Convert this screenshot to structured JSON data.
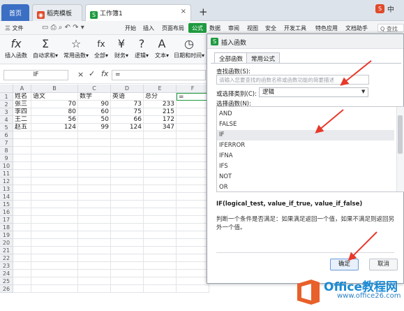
{
  "tabs": {
    "home": "首页",
    "template": "稻壳模板",
    "doc": "工作簿1",
    "close": "×",
    "plus": "+"
  },
  "topright": {
    "badge": "S",
    "lang": "中"
  },
  "menu": {
    "file": "三 文件",
    "items": [
      "开始",
      "插入",
      "页面布局",
      "公式",
      "数据",
      "审阅",
      "视图",
      "安全",
      "开发工具",
      "特色应用",
      "文档助手"
    ],
    "search": "Q 查找"
  },
  "ribbon": [
    {
      "icon": "fx",
      "label": "插入函数"
    },
    {
      "icon": "Σ",
      "label": "自动求和▾"
    },
    {
      "icon": "☆",
      "label": "常用函数▾"
    },
    {
      "icon": "fx",
      "label": "全部▾"
    },
    {
      "icon": "¥",
      "label": "财务▾"
    },
    {
      "icon": "?",
      "label": "逻辑▾"
    },
    {
      "icon": "A",
      "label": "文本▾"
    },
    {
      "icon": "◷",
      "label": "日期和时间▾"
    }
  ],
  "formulabar": {
    "name": "IF",
    "x": "×",
    "check": "✓",
    "fx": "fx",
    "content": "="
  },
  "grid": {
    "columns": [
      "A",
      "B",
      "C",
      "D",
      "E",
      "F"
    ],
    "rows": [
      "1",
      "2",
      "3",
      "4",
      "5",
      "6",
      "7",
      "8",
      "9",
      "10",
      "11",
      "12",
      "13",
      "14",
      "15",
      "16",
      "17",
      "18",
      "19",
      "20",
      "21",
      "22",
      "23",
      "24",
      "25",
      "26"
    ],
    "header": [
      "姓名",
      "语文",
      "数学",
      "英语",
      "总分",
      "="
    ],
    "data": [
      [
        "张三",
        "70",
        "90",
        "73",
        "233"
      ],
      [
        "李四",
        "80",
        "60",
        "75",
        "215"
      ],
      [
        "王二",
        "56",
        "50",
        "66",
        "172"
      ],
      [
        "赵五",
        "124",
        "99",
        "124",
        "347"
      ]
    ]
  },
  "dialog": {
    "title": "插入函数",
    "tabs": [
      "全部函数",
      "常用公式"
    ],
    "find_label": "查找函数(S):",
    "find_placeholder": "请输入您要查找的函数名称或函数功能的简要描述",
    "cat_label": "或选择类别(C):",
    "cat_value": "逻辑",
    "list_label": "选择函数(N):",
    "functions": [
      "AND",
      "FALSE",
      "IF",
      "IFERROR",
      "IFNA",
      "IFS",
      "NOT",
      "OR"
    ],
    "selected": "IF",
    "signature": "IF(logical_test, value_if_true, value_if_false)",
    "description": "判断一个条件是否满足：如果满足返回一个值，如果不满足则返回另外一个值。",
    "ok": "确定",
    "cancel": "取消"
  },
  "watermark": {
    "title": "Office教程网",
    "url": "www.office26.com"
  },
  "colors": {
    "green": "#1e9a3f",
    "blue": "#3b6fc4",
    "arrow": "#e8382a"
  }
}
